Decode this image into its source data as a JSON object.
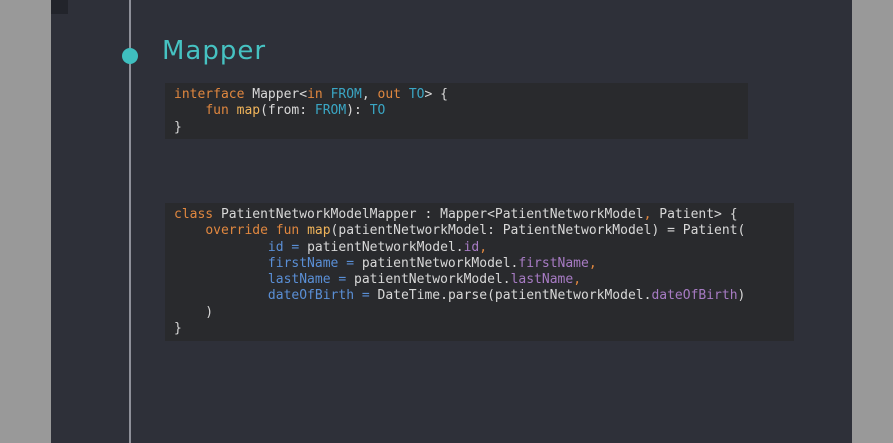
{
  "slide": {
    "heading": "Mapper"
  },
  "code_block_1": {
    "lines": [
      [
        {
          "t": "interface ",
          "c": "kw"
        },
        {
          "t": "Mapper<",
          "c": "pl"
        },
        {
          "t": "in ",
          "c": "kw"
        },
        {
          "t": "FROM",
          "c": "ty"
        },
        {
          "t": ", ",
          "c": "pl"
        },
        {
          "t": "out ",
          "c": "kw"
        },
        {
          "t": "TO",
          "c": "ty"
        },
        {
          "t": "> {",
          "c": "pl"
        }
      ],
      [
        {
          "t": "    ",
          "c": "pl"
        },
        {
          "t": "fun ",
          "c": "kw"
        },
        {
          "t": "map",
          "c": "fn"
        },
        {
          "t": "(from: ",
          "c": "pl"
        },
        {
          "t": "FROM",
          "c": "ty"
        },
        {
          "t": "): ",
          "c": "pl"
        },
        {
          "t": "TO",
          "c": "ty"
        }
      ],
      [
        {
          "t": "}",
          "c": "pl"
        }
      ]
    ]
  },
  "code_block_2": {
    "lines": [
      [
        {
          "t": "class ",
          "c": "kw"
        },
        {
          "t": "PatientNetworkModelMapper : Mapper<PatientNetworkModel",
          "c": "pl"
        },
        {
          "t": ", ",
          "c": "kw"
        },
        {
          "t": "Patient> {",
          "c": "pl"
        }
      ],
      [
        {
          "t": "    ",
          "c": "pl"
        },
        {
          "t": "override fun ",
          "c": "kw"
        },
        {
          "t": "map",
          "c": "fn"
        },
        {
          "t": "(patientNetworkModel: PatientNetworkModel) = Patient(",
          "c": "pl"
        }
      ],
      [
        {
          "t": "            ",
          "c": "pl"
        },
        {
          "t": "id = ",
          "c": "field"
        },
        {
          "t": "patientNetworkModel.",
          "c": "pl"
        },
        {
          "t": "id",
          "c": "prop"
        },
        {
          "t": ",",
          "c": "kw"
        }
      ],
      [
        {
          "t": "            ",
          "c": "pl"
        },
        {
          "t": "firstName = ",
          "c": "field"
        },
        {
          "t": "patientNetworkModel.",
          "c": "pl"
        },
        {
          "t": "firstName",
          "c": "prop"
        },
        {
          "t": ",",
          "c": "kw"
        }
      ],
      [
        {
          "t": "            ",
          "c": "pl"
        },
        {
          "t": "lastName = ",
          "c": "field"
        },
        {
          "t": "patientNetworkModel.",
          "c": "pl"
        },
        {
          "t": "lastName",
          "c": "prop"
        },
        {
          "t": ",",
          "c": "kw"
        }
      ],
      [
        {
          "t": "            ",
          "c": "pl"
        },
        {
          "t": "dateOfBirth = ",
          "c": "field"
        },
        {
          "t": "DateTime.parse(patientNetworkModel.",
          "c": "pl"
        },
        {
          "t": "dateOfBirth",
          "c": "prop"
        },
        {
          "t": ")",
          "c": "pl"
        }
      ],
      [
        {
          "t": "    )",
          "c": "pl"
        }
      ],
      [
        {
          "t": "}",
          "c": "pl"
        }
      ]
    ]
  },
  "colors": {
    "background": "#2e3039",
    "accent": "#46c2c2",
    "code_background": "#292a2d",
    "keyword": "#e0873f",
    "function": "#f0b45a",
    "type": "#3aa6c4",
    "property": "#a77bc4",
    "named_argument": "#5a8fd6"
  }
}
